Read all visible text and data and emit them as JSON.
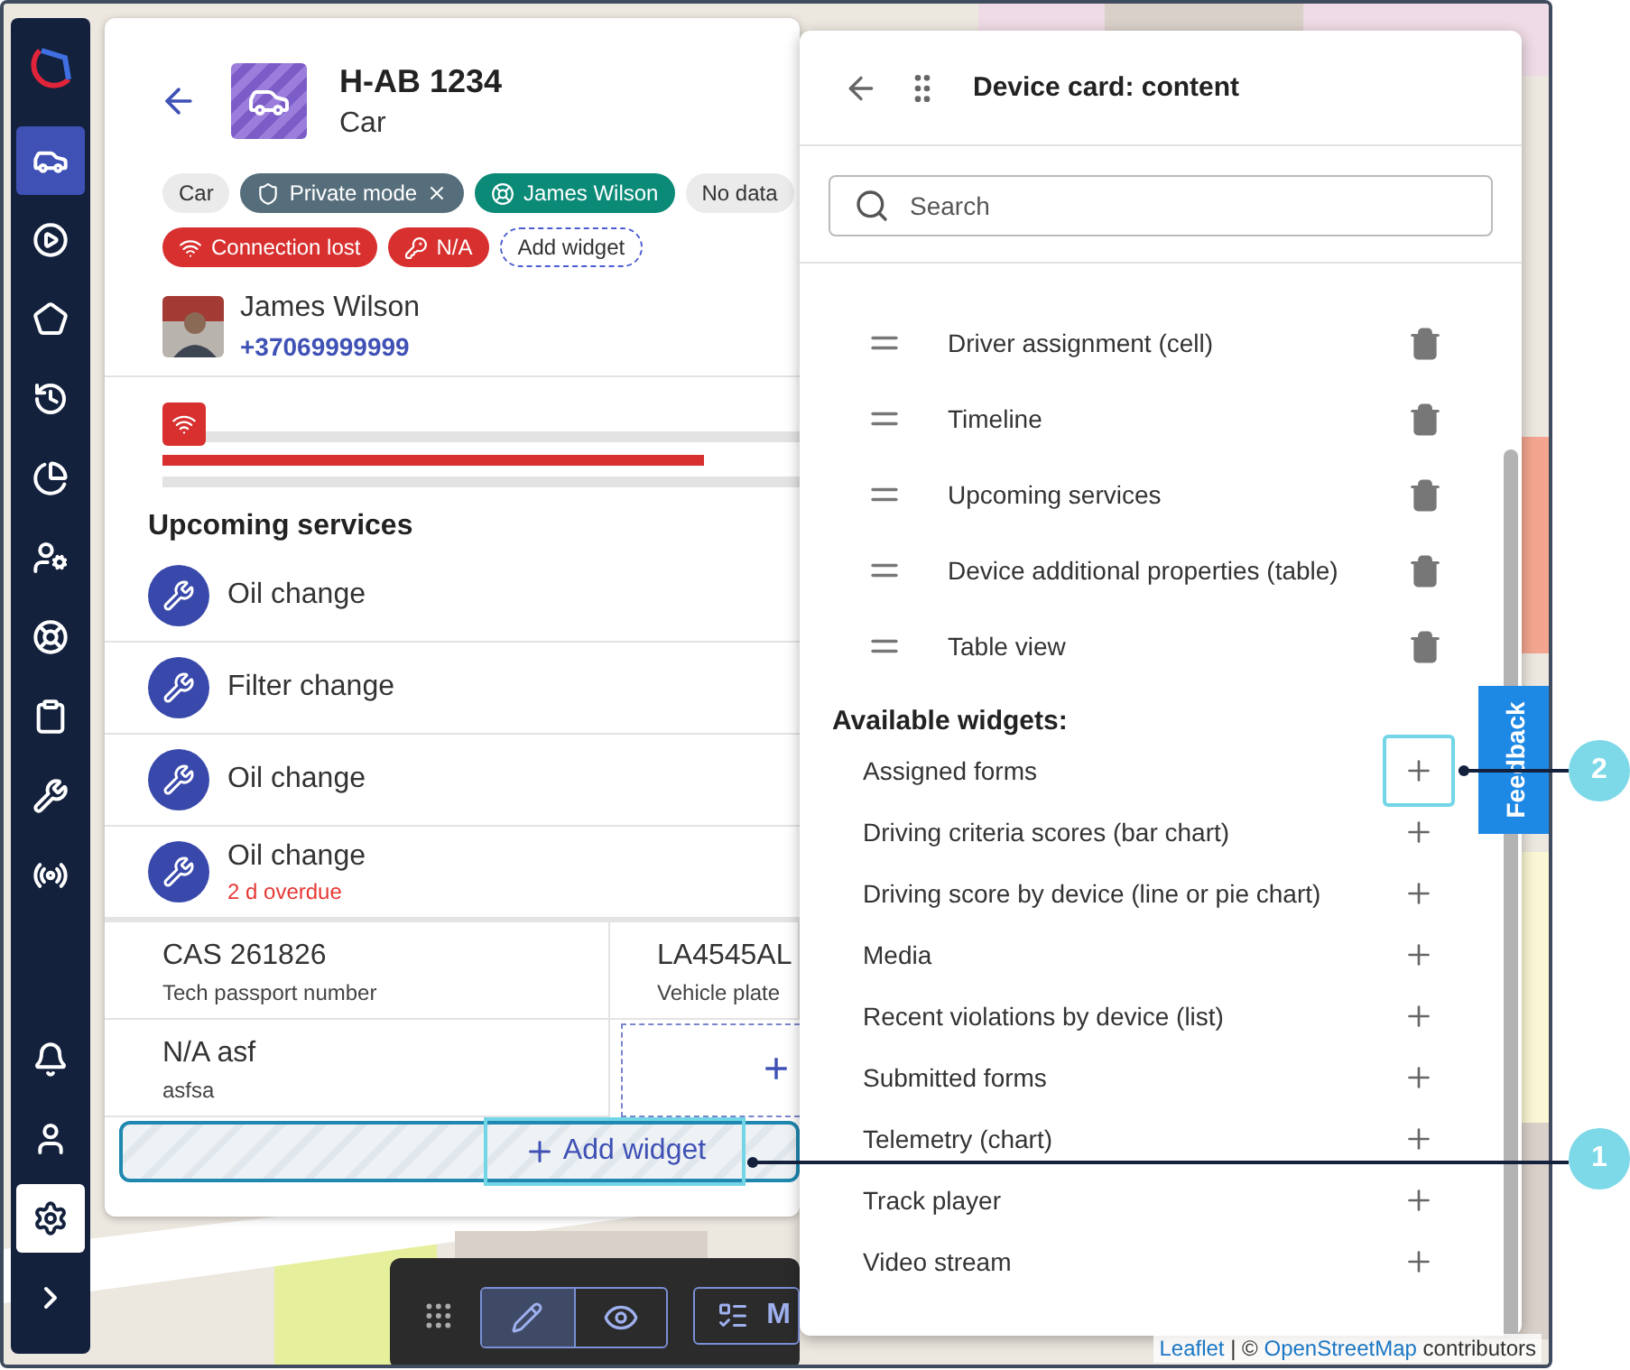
{
  "sidebar": {
    "items": [
      {
        "kind": "vehicles",
        "selected": true
      },
      {
        "kind": "play",
        "selected": false
      },
      {
        "kind": "zones",
        "selected": false
      },
      {
        "kind": "history",
        "selected": false
      },
      {
        "kind": "reports",
        "selected": false
      },
      {
        "kind": "users",
        "selected": false
      },
      {
        "kind": "drivers",
        "selected": false
      },
      {
        "kind": "tasks",
        "selected": false
      },
      {
        "kind": "maintenance",
        "selected": false
      },
      {
        "kind": "devices",
        "selected": false
      }
    ],
    "bottom_items": [
      {
        "kind": "notifications",
        "selected": false
      },
      {
        "kind": "account",
        "selected": false
      },
      {
        "kind": "settings",
        "selected": true
      },
      {
        "kind": "expand",
        "selected": false
      }
    ]
  },
  "device_card": {
    "title": "H-AB 1234",
    "subtitle": "Car",
    "chips": [
      {
        "kind": "plain",
        "label": "Car"
      },
      {
        "kind": "private",
        "label": "Private mode"
      },
      {
        "kind": "driver",
        "label": "James Wilson"
      },
      {
        "kind": "plain",
        "label": "No data"
      },
      {
        "kind": "connection",
        "label": "Connection lost"
      },
      {
        "kind": "key",
        "label": "N/A"
      },
      {
        "kind": "add",
        "label": "Add widget"
      }
    ],
    "driver": {
      "name": "James Wilson",
      "phone": "+37069999999"
    },
    "timeline": {
      "level": 0.85
    },
    "services_title": "Upcoming services",
    "services": [
      {
        "name": "Oil change"
      },
      {
        "name": "Filter change"
      },
      {
        "name": "Oil change"
      },
      {
        "name": "Oil change",
        "status": "2 d overdue"
      }
    ],
    "properties": [
      {
        "kind": "value",
        "value": "CAS 261826",
        "label": "Tech passport number"
      },
      {
        "kind": "value",
        "value": "LA4545AL",
        "label": "Vehicle plate"
      },
      {
        "kind": "value",
        "value": "N/A asf",
        "label": "asfsa"
      },
      {
        "kind": "add",
        "value": "+"
      }
    ],
    "add_widget": {
      "label": "Add widget",
      "highlighted": true
    }
  },
  "content_panel": {
    "title": "Device card: content",
    "search": {
      "placeholder": "Search"
    },
    "widgets": [
      {
        "label": "Driver assignment (cell)"
      },
      {
        "label": "Timeline"
      },
      {
        "label": "Upcoming services"
      },
      {
        "label": "Device additional properties (table)"
      },
      {
        "label": "Table view"
      }
    ],
    "available_title": "Available widgets:",
    "available": [
      {
        "label": "Assigned forms",
        "highlighted": true
      },
      {
        "label": "Driving criteria scores (bar chart)",
        "highlighted": false
      },
      {
        "label": "Driving score by device (line or pie chart)",
        "highlighted": false
      },
      {
        "label": "Media",
        "highlighted": false
      },
      {
        "label": "Recent violations by device (list)",
        "highlighted": false
      },
      {
        "label": "Submitted forms",
        "highlighted": false
      },
      {
        "label": "Telemetry (chart)",
        "highlighted": false
      },
      {
        "label": "Track player",
        "highlighted": false
      },
      {
        "label": "Video stream",
        "highlighted": false
      }
    ]
  },
  "feedback": "Feedback",
  "toolbar": {
    "modes": [
      {
        "kind": "edit",
        "selected": true
      },
      {
        "kind": "preview",
        "selected": false
      }
    ],
    "button": "M"
  },
  "attribution": {
    "links": [
      "Leaflet",
      "OpenStreetMap"
    ],
    "separator": "| ©",
    "suffix": "contributors"
  },
  "callouts": [
    {
      "number": "2"
    },
    {
      "number": "1"
    }
  ]
}
